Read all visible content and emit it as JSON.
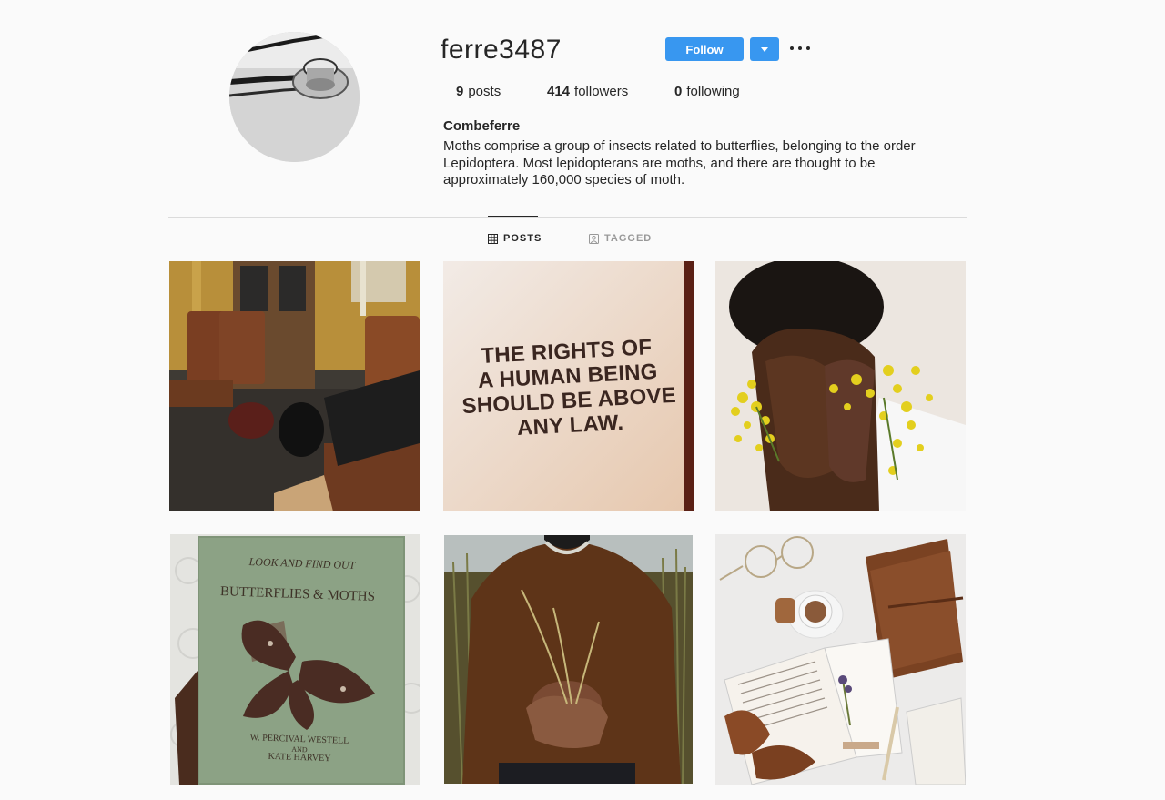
{
  "profile": {
    "username": "ferre3487",
    "full_name": "Combeferre",
    "bio": "Moths comprise a group of insects related to butterflies, belonging to the order Lepidoptera. Most lepidopterans are moths, and there are thought to be approximately 160,000 species of moth.",
    "avatar_icon": "stethoscope-icon"
  },
  "actions": {
    "follow_label": "Follow",
    "dropdown_icon": "caret-down-icon",
    "more_icon": "more-options-icon"
  },
  "stats": {
    "posts_count": "9",
    "posts_label": "posts",
    "followers_count": "414",
    "followers_label": "followers",
    "following_count": "0",
    "following_label": "following"
  },
  "tabs": [
    {
      "label": "POSTS",
      "icon": "grid-icon",
      "active": true
    },
    {
      "label": "TAGGED",
      "icon": "tagged-icon",
      "active": false
    }
  ],
  "posts": [
    {
      "subject": "train-interior"
    },
    {
      "subject": "sign",
      "text_lines": [
        "THE RIGHTS OF",
        "A HUMAN BEING",
        "SHOULD BE ABOVE",
        "ANY LAW."
      ]
    },
    {
      "subject": "hands-with-flowers"
    },
    {
      "subject": "book-with-moth",
      "text_lines": [
        "LOOK AND FIND OUT",
        "BUTTERFLIES & MOTHS",
        "W. PERCIVAL WESTELL",
        "AND",
        "KATE HARVEY"
      ]
    },
    {
      "subject": "person-with-grass"
    },
    {
      "subject": "desk-still-life"
    }
  ],
  "colors": {
    "accent": "#3897f0",
    "background": "#fafafa",
    "text": "#262626",
    "muted": "#999999"
  }
}
